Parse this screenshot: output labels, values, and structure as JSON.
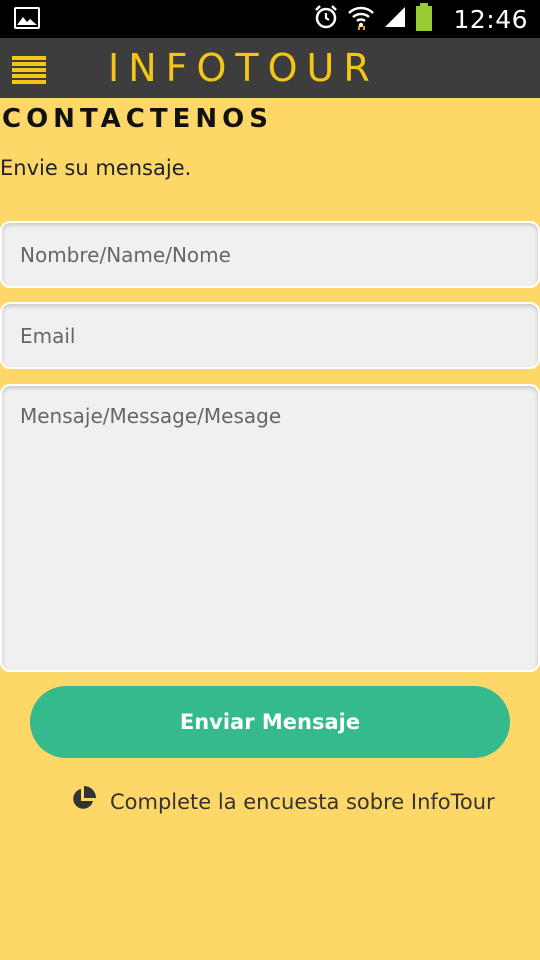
{
  "status_bar": {
    "time": "12:46",
    "icons": [
      "image-icon",
      "alarm-icon",
      "wifi-icon",
      "signal-icon",
      "battery-icon"
    ]
  },
  "app_bar": {
    "title": "INFOTOUR",
    "menu_icon": "hamburger-menu-icon",
    "accent_color": "#f5c518",
    "background_color": "#3d3d3d"
  },
  "page": {
    "title": "CONTACTENOS",
    "subtitle": "Envie su mensaje.",
    "background_color": "#fdd869"
  },
  "form": {
    "name_placeholder": "Nombre/Name/Nome",
    "email_placeholder": "Email",
    "message_placeholder": "Mensaje/Message/Mesage",
    "submit_label": "Enviar Mensaje",
    "submit_color": "#34ba8c"
  },
  "survey": {
    "icon": "pie-chart-icon",
    "label": "Complete la encuesta sobre InfoTour"
  }
}
